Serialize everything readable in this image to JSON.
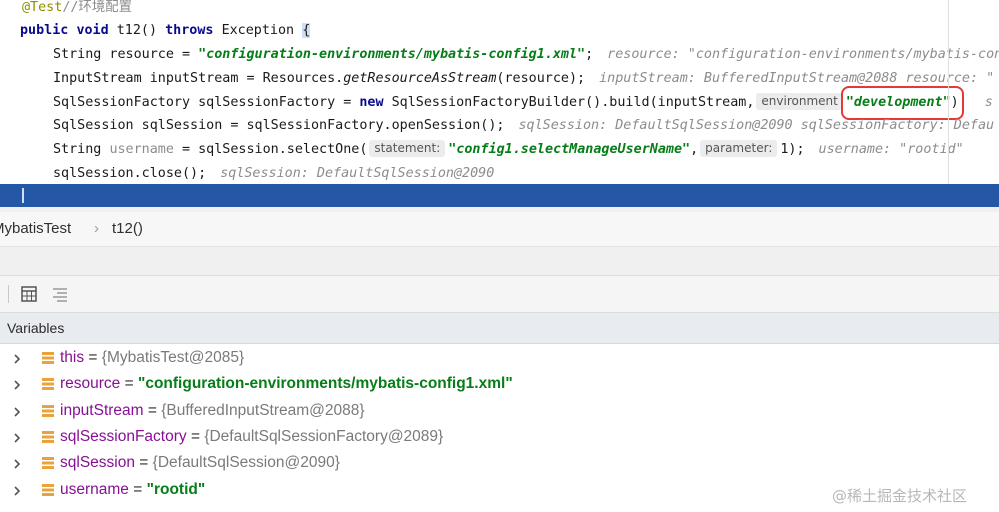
{
  "editor": {
    "lines": {
      "annotation": "@Test",
      "comment": "//环境配置",
      "l1": {
        "kw1": "public",
        "kw2": "void",
        "method": "t12()",
        "kw3": "throws",
        "exc": "Exception",
        "brace": "{"
      },
      "l2": {
        "decl": "String resource = ",
        "str": "\"configuration-environments/mybatis-config1.xml\"",
        "semi": ";",
        "hint": "resource: \"configuration-environments/mybatis-con"
      },
      "l3": {
        "decl": "InputStream inputStream = Resources.",
        "call": "getResourceAsStream",
        "args": "(resource);",
        "hint": "inputStream: BufferedInputStream@2088  resource: \""
      },
      "l4": {
        "decl": "SqlSessionFactory sqlSessionFactory = ",
        "kw": "new",
        "call": " SqlSessionFactoryBuilder().build(inputStream,",
        "inlay": "environment",
        "str": "\"development\"",
        "close": ")",
        "hint": "s"
      },
      "l5": {
        "decl": "SqlSession sqlSession = sqlSessionFactory.openSession();",
        "hint": "sqlSession: DefaultSqlSession@2090  sqlSessionFactory: Defau"
      },
      "l6": {
        "decl": "String ",
        "grey": "username",
        "rest": " = sqlSession.selectOne(",
        "inlay1": "statement:",
        "str": "\"config1.selectManageUserName\"",
        "comma": ",",
        "inlay2": "parameter:",
        "num": "1);",
        "hint": "username: \"rootid\""
      },
      "l7": {
        "decl": "sqlSession.close();",
        "hint": "sqlSession: DefaultSqlSession@2090"
      }
    }
  },
  "breadcrumb": {
    "class_name": "MybatisTest",
    "separator": "›",
    "method": "t12()"
  },
  "toolbar": {
    "icons": [
      "table-view-icon",
      "collapse-view-icon"
    ]
  },
  "variables": {
    "title": "Variables",
    "rows": [
      {
        "name": "this",
        "eq": " = ",
        "value": "{MybatisTest@2085}",
        "kind": "obj"
      },
      {
        "name": "resource",
        "eq": " = ",
        "value": "\"configuration-environments/mybatis-config1.xml\"",
        "kind": "str"
      },
      {
        "name": "inputStream",
        "eq": " = ",
        "value": "{BufferedInputStream@2088}",
        "kind": "obj"
      },
      {
        "name": "sqlSessionFactory",
        "eq": " = ",
        "value": "{DefaultSqlSessionFactory@2089}",
        "kind": "obj"
      },
      {
        "name": "sqlSession",
        "eq": " = ",
        "value": "{DefaultSqlSession@2090}",
        "kind": "obj"
      },
      {
        "name": "username",
        "eq": " = ",
        "value": "\"rootid\"",
        "kind": "str"
      }
    ]
  },
  "watermark": "@稀土掘金技术社区",
  "colors": {
    "selection": "#2557a7",
    "highlight_box": "#e53935",
    "string": "#067d17",
    "keyword": "#0a0a8f",
    "field_icon": "#e8a33d"
  }
}
